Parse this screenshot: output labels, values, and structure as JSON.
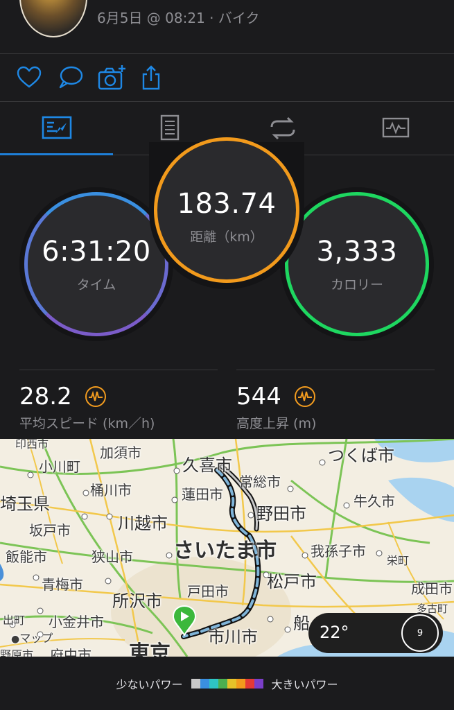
{
  "activity": {
    "meta": "6月5日 @ 08:21 · バイク"
  },
  "actions": {
    "icons": [
      "heart-icon",
      "comment-icon",
      "camera-add-icon",
      "share-icon"
    ],
    "accent": "#1e88e5"
  },
  "tabs": [
    "overview-icon",
    "details-icon",
    "laps-icon",
    "graph-icon"
  ],
  "rings": {
    "time": {
      "value": "6:31:20",
      "label": "タイム",
      "colors": [
        "#3a8fe0",
        "#7b5cc9"
      ]
    },
    "distance": {
      "value": "183.74",
      "label": "距離（km）",
      "color": "#f29a1c"
    },
    "calories": {
      "value": "3,333",
      "label": "カロリー",
      "color": "#1ed760"
    }
  },
  "stats": {
    "avg_speed": {
      "value": "28.2",
      "label": "平均スピード (km／h)"
    },
    "elevation": {
      "value": "544",
      "label": "高度上昇 (m)"
    }
  },
  "map": {
    "cities": {
      "kazo": "加須市",
      "kuki": "久喜市",
      "tsukuba": "つくば市",
      "ogawa": "小川町",
      "okegawa": "桶川市",
      "josou": "常総市",
      "saitama_ken": "埼玉県",
      "hasuda": "蓮田市",
      "ushiku": "牛久市",
      "noda": "野田市",
      "sakado": "坂戸市",
      "kawagoe": "川越市",
      "saitama": "さいたま市",
      "abiko": "我孫子市",
      "hanno": "飯能市",
      "sayama": "狭山市",
      "sakae": "栄町",
      "matsudo": "松戸市",
      "ome": "青梅市",
      "narita": "成田市",
      "tokorozawa": "所沢市",
      "toda": "戸田市",
      "tako": "多古町",
      "hinode": "出町",
      "koganei": "小金井市",
      "ichikawa": "市川市",
      "funa": "船",
      "fuchu": "府中市",
      "tokyo": "東京",
      "nodo": "野原市",
      "imba": "印西市"
    },
    "attribution": "マップ",
    "temperature": "22°",
    "wind": "9"
  },
  "legend": {
    "low": "少ないパワー",
    "high": "大きいパワー",
    "colors": [
      "#c8c8c8",
      "#3a8fe0",
      "#2ec4c4",
      "#4caf50",
      "#e6c229",
      "#f29a1c",
      "#e53935",
      "#7b3fc9"
    ]
  }
}
